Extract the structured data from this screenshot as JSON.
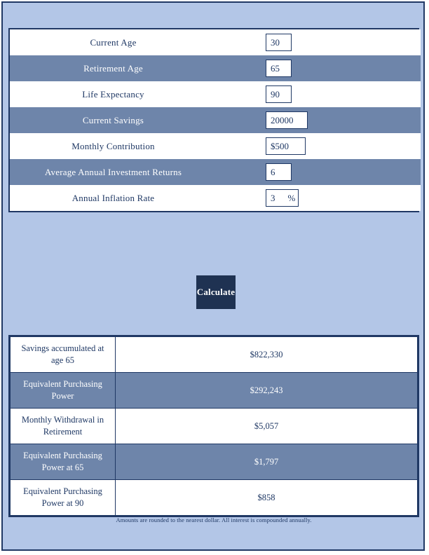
{
  "page": {
    "background_color": "#b3c6e7",
    "border_color": "#203864",
    "accent_color": "#6e85aa",
    "text_color": "#1f3864",
    "button_color": "#1f3252"
  },
  "form": {
    "rows": [
      {
        "label": "Current Age",
        "value": "30",
        "suffix": "",
        "stripe": "odd"
      },
      {
        "label": "Retirement Age",
        "value": "65",
        "suffix": "",
        "stripe": "even"
      },
      {
        "label": "Life Expectancy",
        "value": "90",
        "suffix": "",
        "stripe": "odd"
      },
      {
        "label": "Current Savings",
        "value": "20000",
        "suffix": "",
        "stripe": "even"
      },
      {
        "label": "Monthly Contribution",
        "value": "$500",
        "suffix": "",
        "stripe": "odd"
      },
      {
        "label": "Average Annual Investment Returns",
        "value": "6",
        "suffix": "",
        "stripe": "even"
      },
      {
        "label": "Annual Inflation Rate",
        "value": "3",
        "suffix": "%",
        "stripe": "odd"
      }
    ]
  },
  "actions": {
    "calculate_label": "Calculate"
  },
  "results": {
    "rows": [
      {
        "label": "Savings accumulated at age 65",
        "value": "$822,330",
        "stripe": "odd"
      },
      {
        "label": "Equivalent Purchasing Power",
        "value": "$292,243",
        "stripe": "even"
      },
      {
        "label": "Monthly Withdrawal in Retirement",
        "value": "$5,057",
        "stripe": "odd"
      },
      {
        "label": "Equivalent Purchasing Power at 65",
        "value": "$1,797",
        "stripe": "even"
      },
      {
        "label": "Equivalent Purchasing Power at 90",
        "value": "$858",
        "stripe": "odd"
      }
    ]
  },
  "footer": {
    "note": "Amounts are rounded to the nearest dollar. All interest is compounded annually."
  }
}
